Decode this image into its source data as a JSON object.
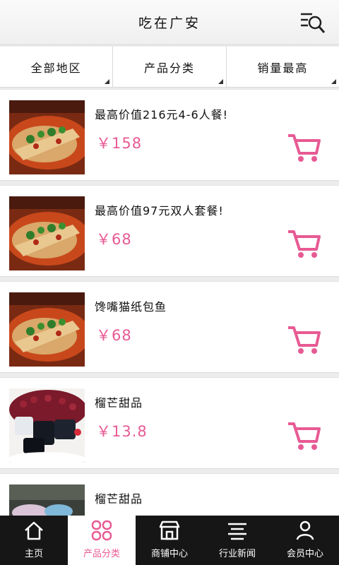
{
  "header": {
    "title": "吃在广安",
    "search_icon": "menu-search-icon"
  },
  "filters": [
    {
      "label": "全部地区"
    },
    {
      "label": "产品分类"
    },
    {
      "label": "销量最高"
    }
  ],
  "products": [
    {
      "name": "最高价值216元4-6人餐!",
      "price": "￥158",
      "image": "fish-dish"
    },
    {
      "name": "最高价值97元双人套餐!",
      "price": "￥68",
      "image": "fish-dish"
    },
    {
      "name": "馋嘴猫纸包鱼",
      "price": "￥68",
      "image": "fish-dish"
    },
    {
      "name": "榴芒甜品",
      "price": "￥13.8",
      "image": "dessert"
    },
    {
      "name": "榴芒甜品",
      "price": "",
      "image": "dessert-2"
    }
  ],
  "tabs": [
    {
      "label": "主页",
      "icon": "home-icon"
    },
    {
      "label": "产品分类",
      "icon": "category-icon",
      "active": true
    },
    {
      "label": "商铺中心",
      "icon": "shop-icon"
    },
    {
      "label": "行业新闻",
      "icon": "news-icon"
    },
    {
      "label": "会员中心",
      "icon": "user-icon"
    }
  ],
  "colors": {
    "accent": "#e85a94",
    "tabbar": "#161616"
  }
}
